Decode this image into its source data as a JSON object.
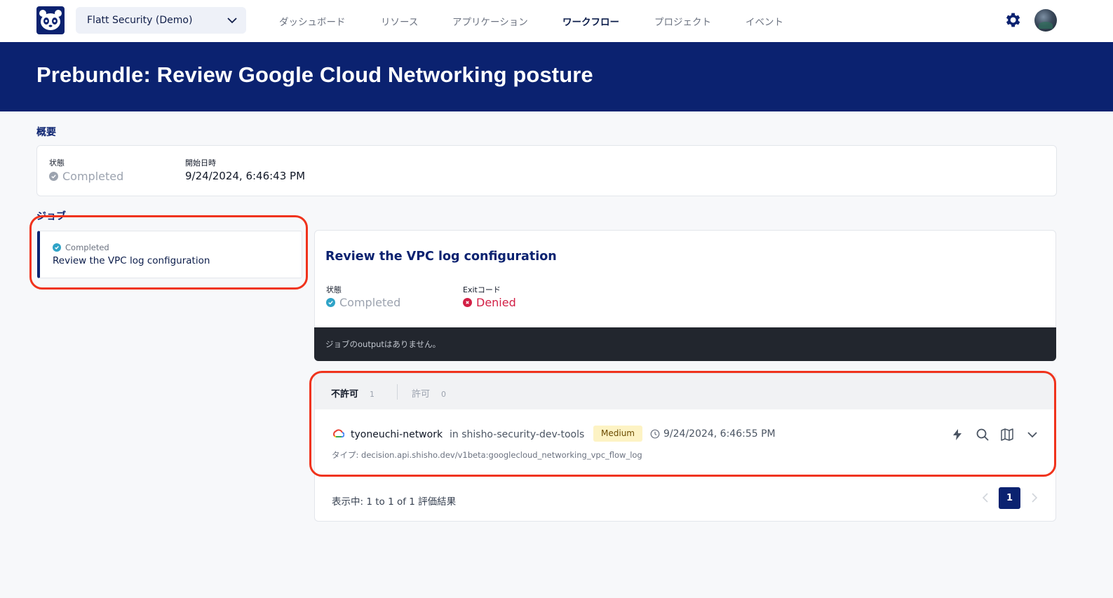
{
  "org": {
    "name": "Flatt Security (Demo)"
  },
  "nav": [
    {
      "label": "ダッシュボード"
    },
    {
      "label": "リソース"
    },
    {
      "label": "アプリケーション"
    },
    {
      "label": "ワークフロー"
    },
    {
      "label": "プロジェクト"
    },
    {
      "label": "イベント"
    }
  ],
  "page": {
    "title": "Prebundle: Review Google Cloud Networking posture"
  },
  "overview": {
    "heading": "概要",
    "status_label": "状態",
    "status_value": "Completed",
    "start_label": "開始日時",
    "start_value": "9/24/2024, 6:46:43 PM"
  },
  "jobs": {
    "heading": "ジョブ",
    "items": [
      {
        "status": "Completed",
        "title": "Review the VPC log configuration"
      }
    ]
  },
  "job_detail": {
    "title": "Review the VPC log configuration",
    "status_label": "状態",
    "status_value": "Completed",
    "exit_label": "Exitコード",
    "exit_value": "Denied",
    "output_text": "ジョブのoutputはありません。"
  },
  "result_tabs": [
    {
      "label": "不許可",
      "count": "1"
    },
    {
      "label": "許可",
      "count": "0"
    }
  ],
  "results": [
    {
      "resource": "tyoneuchi-network",
      "project": "in shisho-security-dev-tools",
      "severity": "Medium",
      "timestamp": "9/24/2024, 6:46:55 PM",
      "type": "タイプ: decision.api.shisho.dev/v1beta:googlecloud_networking_vpc_flow_log"
    }
  ],
  "pagination": {
    "summary": "表示中: 1 to 1 of 1 評価結果",
    "current_page": "1"
  },
  "colors": {
    "brand_navy": "#0b2270",
    "highlight_red": "#f0331c",
    "denied_red": "#d21f45",
    "completed_teal": "#2fa3c7",
    "medium_badge": "#fdf3c4"
  },
  "icons": [
    "panda-logo-icon",
    "chevron-down-icon",
    "gear-icon",
    "check-circle-icon",
    "x-circle-icon",
    "google-cloud-icon",
    "clock-icon",
    "lightning-icon",
    "search-icon",
    "map-icon",
    "chevron-left-icon",
    "chevron-right-icon"
  ]
}
